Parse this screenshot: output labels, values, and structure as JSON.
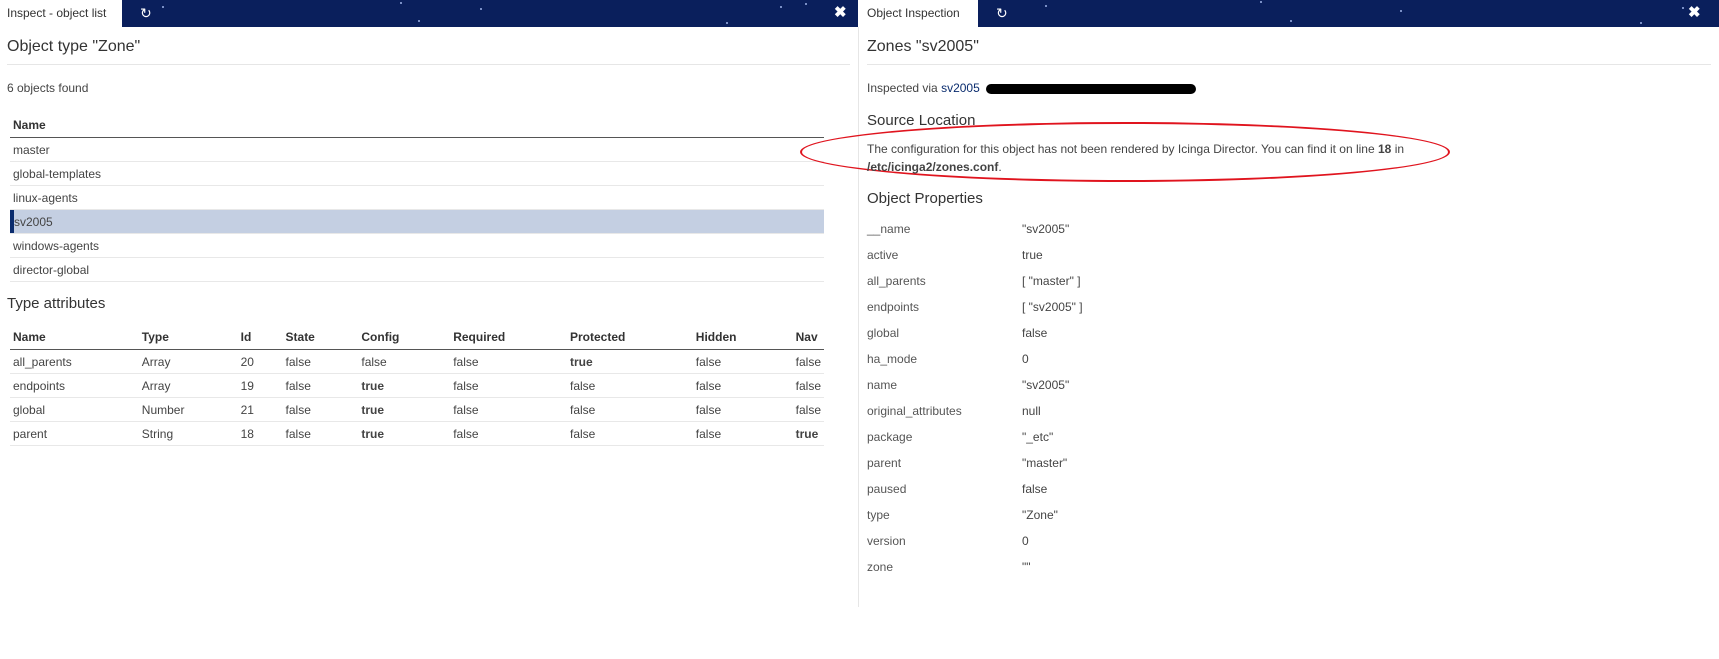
{
  "left": {
    "tab_label": "Inspect - object list",
    "refresh_icon": "↻",
    "close_icon": "✖",
    "title": "Object type \"Zone\"",
    "count_text": "6 objects found",
    "name_header": "Name",
    "objects": [
      "master",
      "global-templates",
      "linux-agents",
      "sv2005",
      "windows-agents",
      "director-global"
    ],
    "selected_object": "sv2005",
    "type_attributes_heading": "Type attributes",
    "attr_headers": [
      "Name",
      "Type",
      "Id",
      "State",
      "Config",
      "Required",
      "Protected",
      "Hidden",
      "Nav"
    ],
    "attr_rows": [
      [
        "all_parents",
        "Array",
        "20",
        "false",
        "false",
        "false",
        "true",
        "false",
        "false"
      ],
      [
        "endpoints",
        "Array",
        "19",
        "false",
        "true",
        "false",
        "false",
        "false",
        "false"
      ],
      [
        "global",
        "Number",
        "21",
        "false",
        "true",
        "false",
        "false",
        "false",
        "false"
      ],
      [
        "parent",
        "String",
        "18",
        "false",
        "true",
        "false",
        "false",
        "false",
        "true"
      ]
    ]
  },
  "right": {
    "tab_label": "Object Inspection",
    "refresh_icon": "↻",
    "close_icon": "✖",
    "title": "Zones \"sv2005\"",
    "inspected_prefix": "Inspected via",
    "inspected_link": "sv2005",
    "source_heading": "Source Location",
    "source_text": "The configuration for this object has not been rendered by Icinga Director. You can find it on line",
    "source_line": "18",
    "source_in": "in",
    "source_path": "/etc/icinga2/zones.conf",
    "properties_heading": "Object Properties",
    "properties": [
      [
        "__name",
        "\"sv2005\""
      ],
      [
        "active",
        "true"
      ],
      [
        "all_parents",
        "[ \"master\" ]"
      ],
      [
        "endpoints",
        "[ \"sv2005\" ]"
      ],
      [
        "global",
        "false"
      ],
      [
        "ha_mode",
        "0"
      ],
      [
        "name",
        "\"sv2005\""
      ],
      [
        "original_attributes",
        "null"
      ],
      [
        "package",
        "\"_etc\""
      ],
      [
        "parent",
        "\"master\""
      ],
      [
        "paused",
        "false"
      ],
      [
        "type",
        "\"Zone\""
      ],
      [
        "version",
        "0"
      ],
      [
        "zone",
        "\"\""
      ]
    ]
  },
  "colors": {
    "header_bg": "#0a1f5c",
    "selection": "#c4cfe2",
    "annotation": "#e0141e"
  }
}
